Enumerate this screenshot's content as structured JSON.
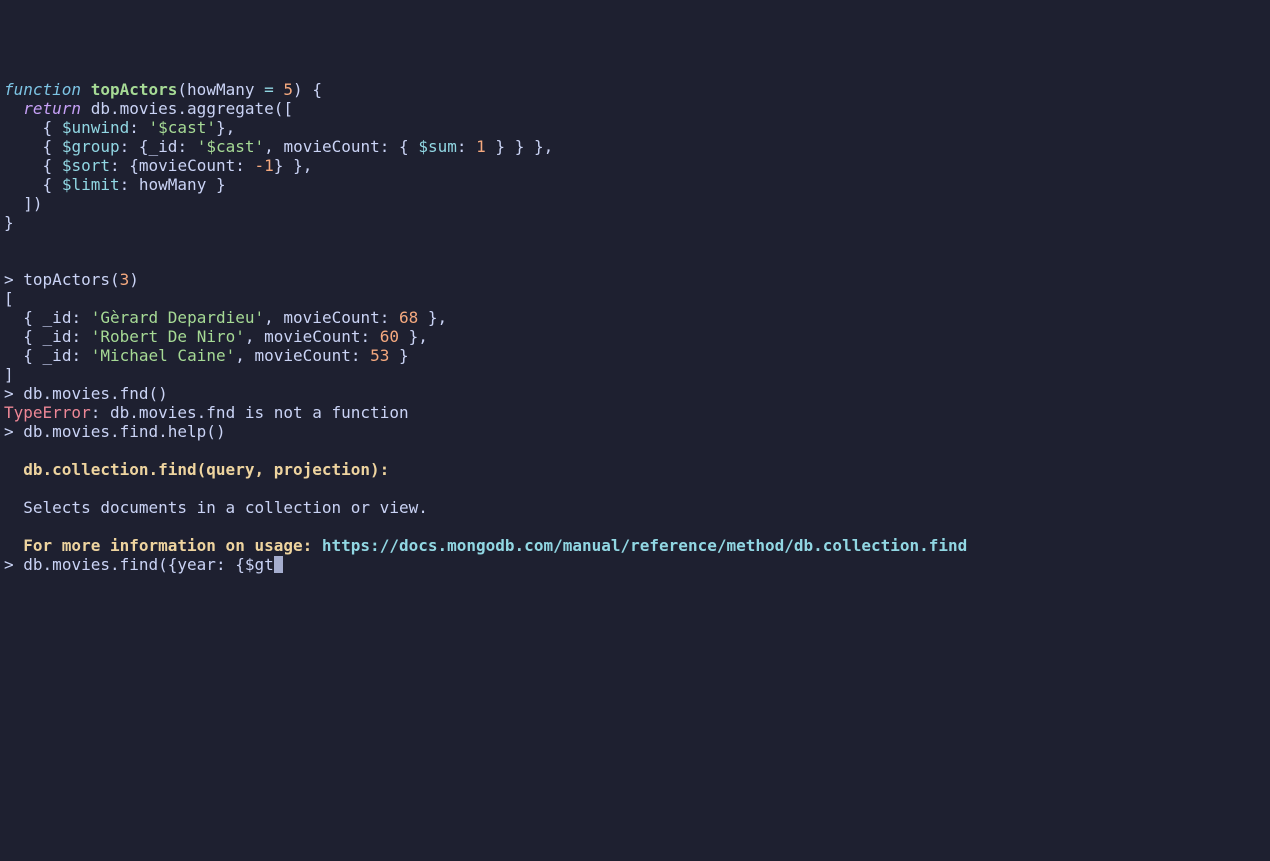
{
  "fnDef": {
    "kw": "function",
    "name": "topActors",
    "paramName": "howMany",
    "eq": "=",
    "paramDefault": "5"
  },
  "ret": "return",
  "db": "db",
  "movies": "movies",
  "aggregate": "aggregate",
  "unwind": "$unwind",
  "castStr": "'$cast'",
  "group": "$group",
  "idKey": "_id",
  "movieCountKey": "movieCount",
  "sum": "$sum",
  "one": "1",
  "sort": "$sort",
  "negOne": "-1",
  "limit": "$limit",
  "howManyRef": "howMany",
  "call": {
    "prompt": ">",
    "fn": "topActors",
    "arg": "3"
  },
  "results": [
    {
      "idKey": "_id",
      "name": "'Gèrard Depardieu'",
      "countKey": "movieCount",
      "count": "68"
    },
    {
      "idKey": "_id",
      "name": "'Robert De Niro'",
      "countKey": "movieCount",
      "count": "60"
    },
    {
      "idKey": "_id",
      "name": "'Michael Caine'",
      "countKey": "movieCount",
      "count": "53"
    }
  ],
  "fndLine": {
    "prompt": ">",
    "text": "db.movies.fnd()"
  },
  "error": {
    "type": "TypeError",
    "msg": ": db.movies.fnd is not a function"
  },
  "helpCall": {
    "prompt": ">",
    "text": "db.movies.find.help()"
  },
  "helpSig": "db.collection.find(query, projection):",
  "helpDesc": "Selects documents in a collection or view.",
  "helpMore": "For more information on usage:",
  "helpUrl": "https://docs.mongodb.com/manual/reference/method/db.collection.find",
  "currentLine": {
    "prompt": ">",
    "text": "db.movies.find({year: {$gt"
  }
}
